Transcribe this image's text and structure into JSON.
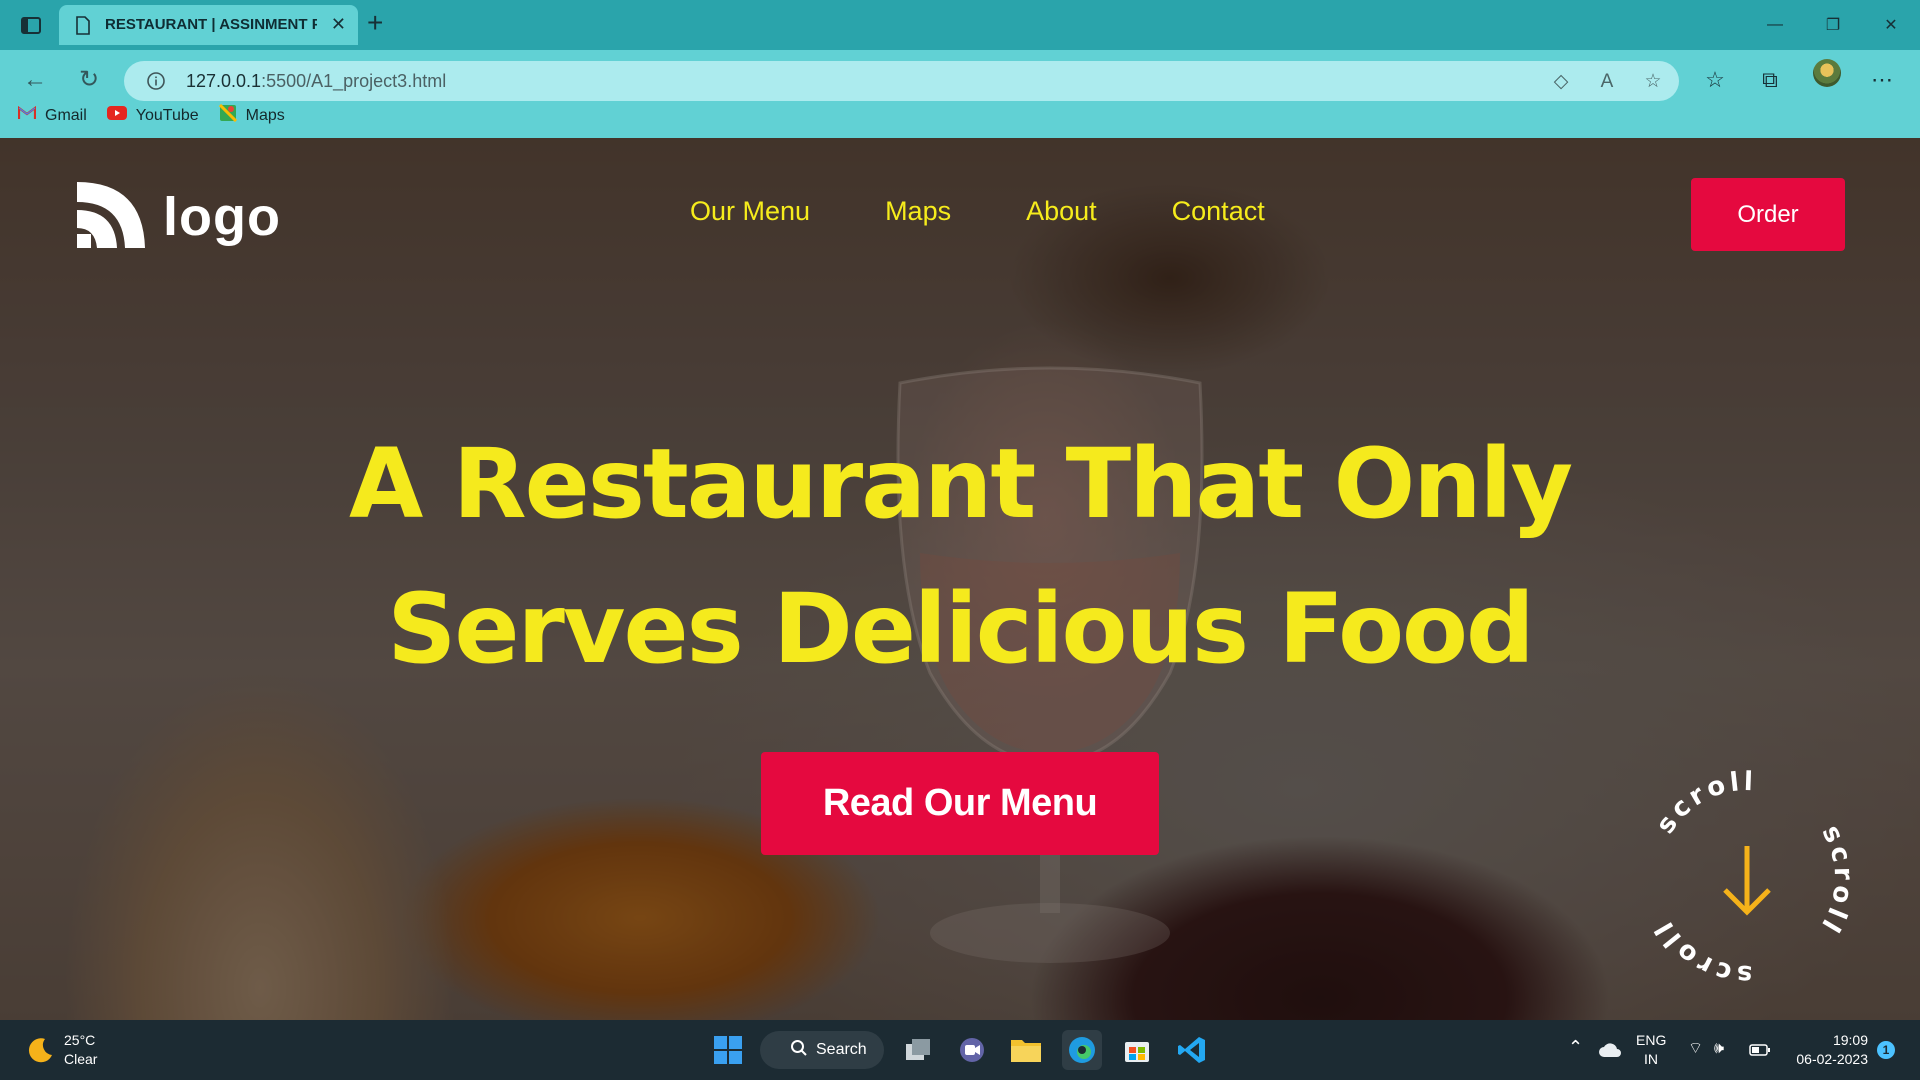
{
  "browser": {
    "tab_title": "RESTAURANT | ASSINMENT PROJECT",
    "url_host": "127.0.0.1",
    "url_path": ":5500/A1_project3.html",
    "bookmarks": [
      {
        "label": "Gmail",
        "icon": "gmail-icon"
      },
      {
        "label": "YouTube",
        "icon": "youtube-icon"
      },
      {
        "label": "Maps",
        "icon": "maps-icon"
      }
    ]
  },
  "site": {
    "logo_text": "logo",
    "nav": [
      "Our Menu",
      "Maps",
      "About",
      "Contact"
    ],
    "order_label": "Order",
    "hero_line1": "A Restaurant That Only",
    "hero_line2": "Serves Delicious Food",
    "cta_label": "Read Our Menu",
    "scroll_text": "scroll",
    "colors": {
      "accent_red": "#e5093f",
      "accent_yellow": "#f5ea1d"
    }
  },
  "taskbar": {
    "weather_temp": "25°C",
    "weather_desc": "Clear",
    "search_label": "Search",
    "lang_top": "ENG",
    "lang_bottom": "IN",
    "time": "19:09",
    "date": "06-02-2023",
    "notification_count": "1"
  }
}
